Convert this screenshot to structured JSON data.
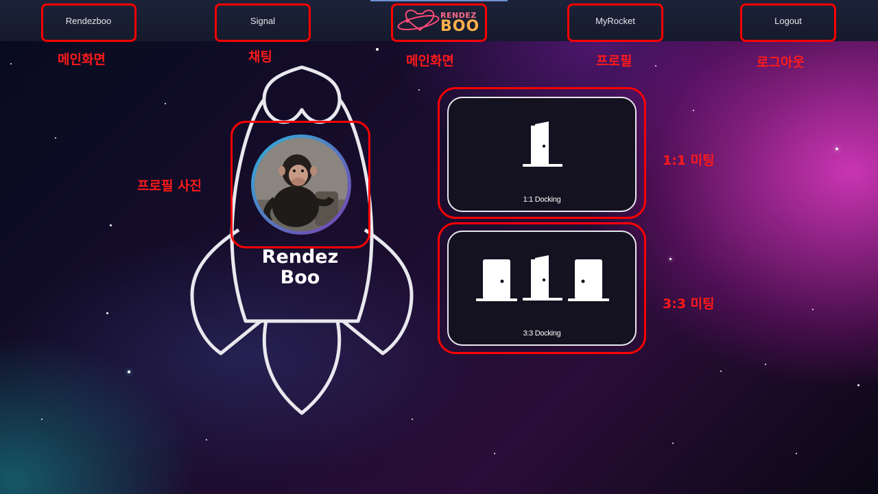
{
  "nav": {
    "rendezboo": "Rendezboo",
    "signal": "Signal",
    "logo_line1": "RENDEZ",
    "logo_line2": "BOO",
    "myrocket": "MyRocket",
    "logout": "Logout"
  },
  "annotations": {
    "main_screen_left": "메인화면",
    "chat": "채팅",
    "main_screen_center": "메인화면",
    "profile": "프로필",
    "logout": "로그아웃",
    "profile_photo": "프로필 사진",
    "meeting_1_1": "1:1 미팅",
    "meeting_3_3": "3:3 미팅"
  },
  "rocket": {
    "name_line1": "Rendez",
    "name_line2": "Boo"
  },
  "docking": {
    "one_to_one_label": "1:1 Docking",
    "three_to_three_label": "3:3 Docking"
  },
  "colors": {
    "annotation_red": "#ff1a1a",
    "logo_pink": "#ff6a8a",
    "logo_orange": "#ffb04a",
    "nav_bg": "#1c2238",
    "accent_gradient_start": "#2fb3d9",
    "accent_gradient_end": "#7a3fb0"
  }
}
